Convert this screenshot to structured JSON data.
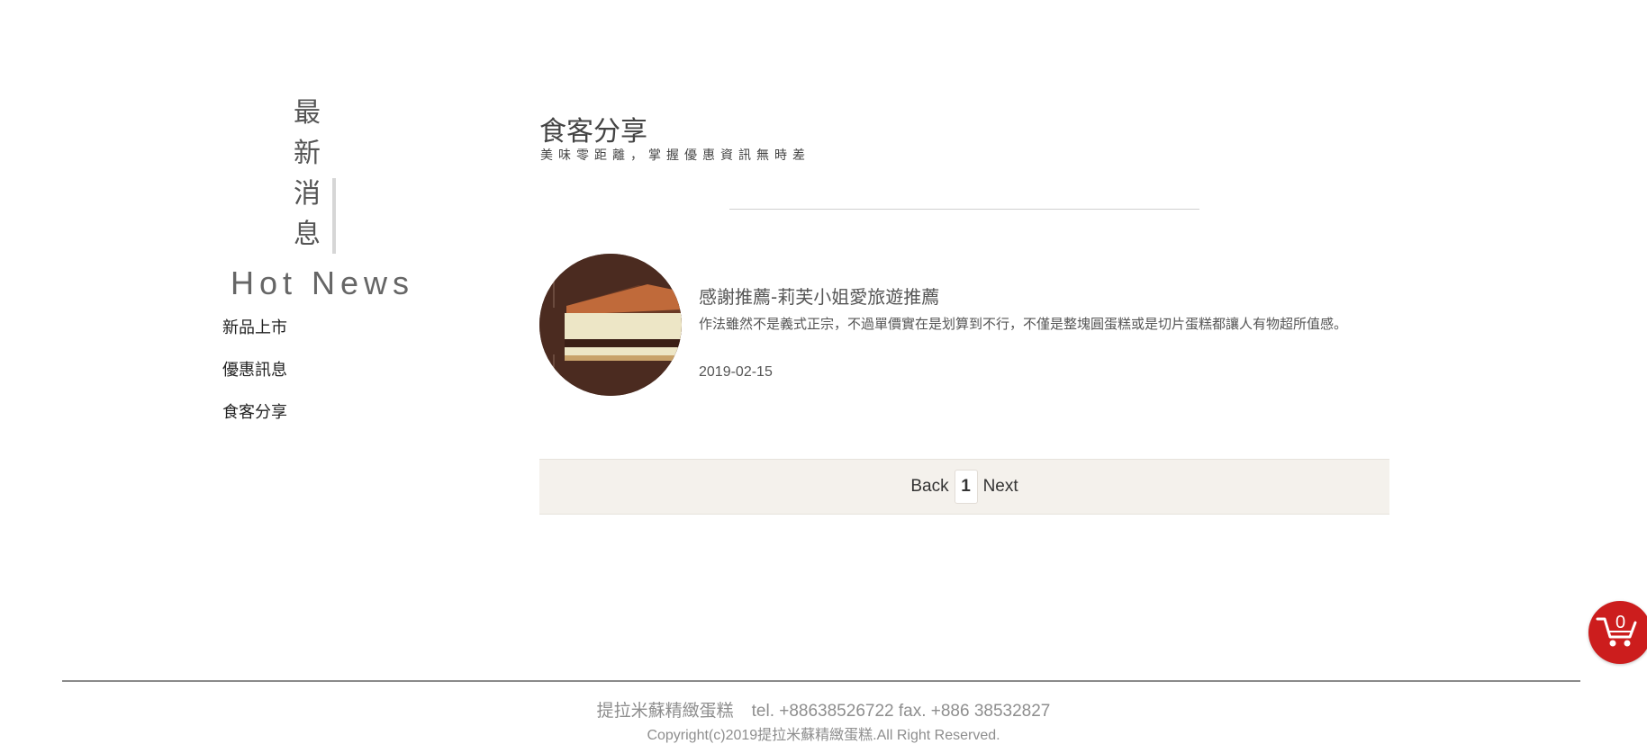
{
  "sidebar": {
    "vertical_title": [
      "最",
      "新",
      "消",
      "息"
    ],
    "english_title": "Hot News",
    "menu": [
      {
        "label": "新品上市"
      },
      {
        "label": "優惠訊息"
      },
      {
        "label": "食客分享"
      }
    ]
  },
  "main": {
    "title": "食客分享",
    "subtitle": "美味零距離，掌握優惠資訊無時差"
  },
  "article": {
    "title": "感謝推薦-莉芙小姐愛旅遊推薦",
    "excerpt": "作法雖然不是義式正宗，不過單價實在是划算到不行，不僅是整塊圓蛋糕或是切片蛋糕都讓人有物超所值感。",
    "date": "2019-02-15"
  },
  "pagination": {
    "back_label": "Back",
    "current_page": "1",
    "next_label": "Next"
  },
  "cart": {
    "count": "0",
    "color": "#cc1d1d"
  },
  "footer": {
    "brand": "提拉米蘇精緻蛋糕",
    "contact": "tel. +88638526722 fax. +886 38532827",
    "copyright": "Copyright(c)2019提拉米蘇精緻蛋糕.All Right Reserved."
  }
}
